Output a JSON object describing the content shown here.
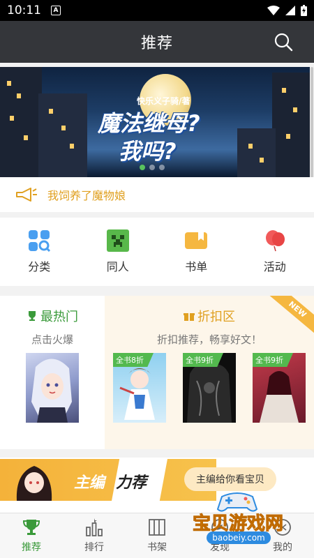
{
  "status_bar": {
    "time": "10:11",
    "notification_badge": "A"
  },
  "header": {
    "title": "推荐",
    "search_icon": "search-icon"
  },
  "banner": {
    "author": "快乐义子骑/著",
    "title_line1": "魔法继母?",
    "title_line2": "我吗?",
    "slides": 3,
    "active_slide": 1
  },
  "notice": {
    "icon": "megaphone-icon",
    "text": "我饲养了魔物娘"
  },
  "categories": [
    {
      "label": "分类",
      "icon": "category-grid-icon",
      "color": "#4a9ff0"
    },
    {
      "label": "同人",
      "icon": "creeper-icon",
      "color": "#58b84a"
    },
    {
      "label": "书单",
      "icon": "booklist-icon",
      "color": "#f5b740"
    },
    {
      "label": "活动",
      "icon": "balloon-icon",
      "color": "#f15a5a"
    }
  ],
  "hottest": {
    "title": "最热门",
    "subtitle": "点击火爆"
  },
  "discount": {
    "title": "折扣区",
    "subtitle": "折扣推荐，畅享好文！",
    "ribbon": "NEW",
    "books": [
      {
        "tag": "全书8折"
      },
      {
        "tag": "全书9折"
      },
      {
        "tag": "全书9折"
      }
    ]
  },
  "editor_pick": {
    "title_part1": "主编",
    "title_part2": "力荐",
    "button": "主编给你看宝贝"
  },
  "tabs": [
    {
      "label": "推荐",
      "icon": "trophy-icon",
      "active": true
    },
    {
      "label": "排行",
      "icon": "ranking-icon",
      "active": false
    },
    {
      "label": "书架",
      "icon": "bookshelf-icon",
      "active": false
    },
    {
      "label": "发现",
      "icon": "discover-icon",
      "active": false
    },
    {
      "label": "我的",
      "icon": "profile-icon",
      "active": false
    }
  ],
  "watermark": {
    "text": "宝贝游戏网",
    "url": "baobeiy.com"
  },
  "colors": {
    "accent_green": "#3a9a3a",
    "notice_gold": "#e0a020",
    "header_bg": "#34363a"
  }
}
